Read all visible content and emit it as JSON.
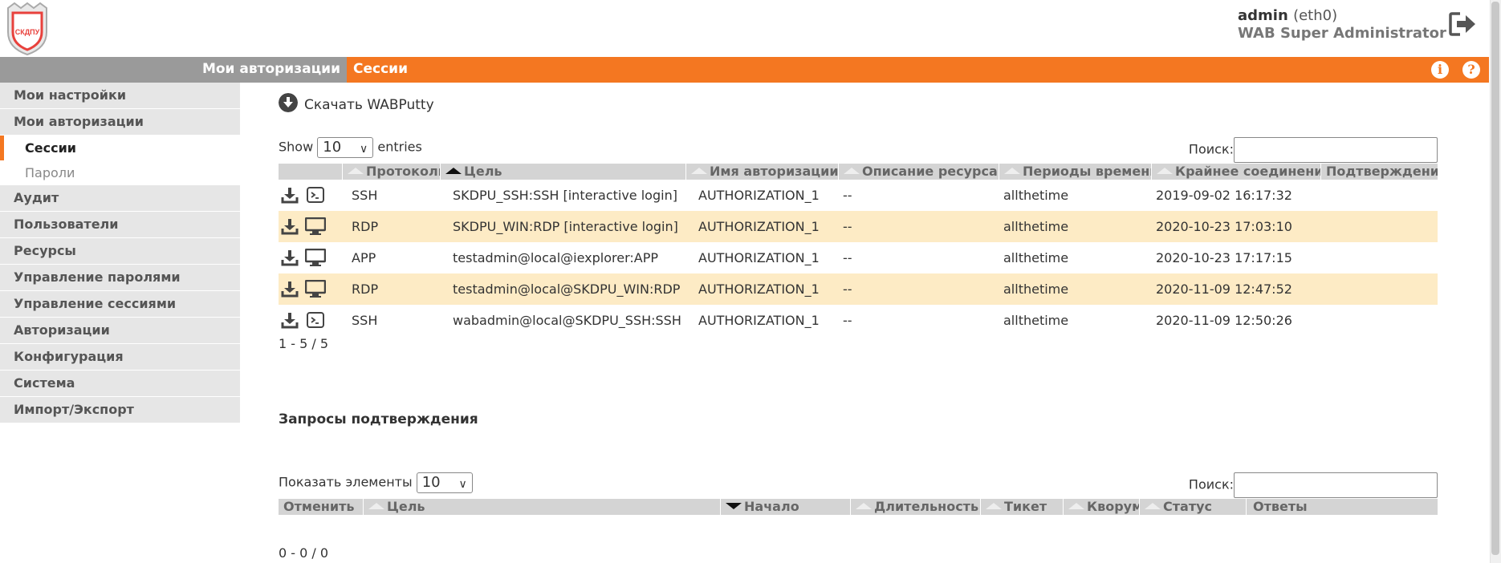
{
  "header": {
    "logo_text": "СКДПУ",
    "user": "admin",
    "interface": "(eth0)",
    "role": "WAB Super Administrator"
  },
  "navbar": {
    "parent": "Мои авторизации",
    "current": "Сессии",
    "info_icon": "i",
    "help_icon": "?"
  },
  "sidebar": {
    "items": [
      {
        "label": "Мои настройки"
      },
      {
        "label": "Мои авторизации"
      },
      {
        "label": "Сессии"
      },
      {
        "label": "Пароли"
      },
      {
        "label": "Аудит"
      },
      {
        "label": "Пользователи"
      },
      {
        "label": "Ресурсы"
      },
      {
        "label": "Управление паролями"
      },
      {
        "label": "Управление сессиями"
      },
      {
        "label": "Авторизации"
      },
      {
        "label": "Конфигурация"
      },
      {
        "label": "Система"
      },
      {
        "label": "Импорт/Экспорт"
      }
    ]
  },
  "sessions": {
    "download_label": "Скачать WABPutty",
    "show_label": "Show",
    "page_size": "10",
    "entries_label": "entries",
    "search_label": "Поиск:",
    "columns": [
      "",
      "Протоколы",
      "Цель",
      "Имя авторизации",
      "Описание ресурса",
      "Периоды времени",
      "Крайнее соединение",
      "Подтверждения"
    ],
    "rows": [
      {
        "icon": "terminal-icon",
        "protocol": "SSH",
        "target": "SKDPU_SSH:SSH [interactive login]",
        "auth": "AUTHORIZATION_1",
        "desc": "--",
        "period": "allthetime",
        "last": "2019-09-02 16:17:32",
        "approval": ""
      },
      {
        "icon": "monitor-icon",
        "protocol": "RDP",
        "target": "SKDPU_WIN:RDP [interactive login]",
        "auth": "AUTHORIZATION_1",
        "desc": "--",
        "period": "allthetime",
        "last": "2020-10-23 17:03:10",
        "approval": ""
      },
      {
        "icon": "monitor-icon",
        "protocol": "APP",
        "target": "testadmin@local@iexplorer:APP",
        "auth": "AUTHORIZATION_1",
        "desc": "--",
        "period": "allthetime",
        "last": "2020-10-23 17:17:15",
        "approval": ""
      },
      {
        "icon": "monitor-icon",
        "protocol": "RDP",
        "target": "testadmin@local@SKDPU_WIN:RDP",
        "auth": "AUTHORIZATION_1",
        "desc": "--",
        "period": "allthetime",
        "last": "2020-11-09 12:47:52",
        "approval": ""
      },
      {
        "icon": "terminal-icon",
        "protocol": "SSH",
        "target": "wabadmin@local@SKDPU_SSH:SSH",
        "auth": "AUTHORIZATION_1",
        "desc": "--",
        "period": "allthetime",
        "last": "2020-11-09 12:50:26",
        "approval": ""
      }
    ],
    "info": "1 - 5 / 5"
  },
  "approvals": {
    "title": "Запросы подтверждения",
    "show_label": "Показать элементы",
    "page_size": "10",
    "search_label": "Поиск:",
    "columns": [
      "Отменить",
      "Цель",
      "Начало",
      "Длительность",
      "Тикет",
      "Кворум",
      "Статус",
      "Ответы"
    ],
    "info": "0 - 0 / 0"
  },
  "colors": {
    "accent": "#f47721",
    "nav_grey": "#9a9a9a",
    "row_highlight": "#fdebc5",
    "header_grey": "#d4d4d4"
  }
}
